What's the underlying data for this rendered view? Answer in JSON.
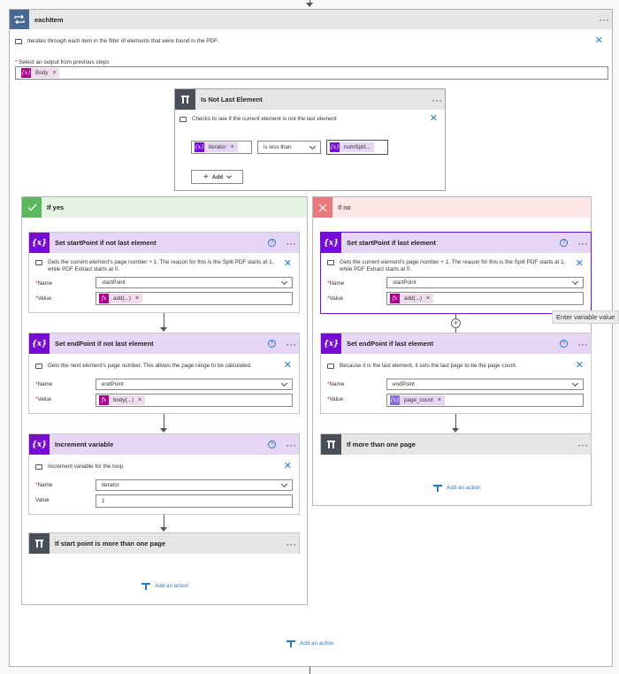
{
  "loop": {
    "title": "eachItem",
    "description": "Iterates through each item in the filter of elements that were found in the PDF.",
    "select_label": "Select an output from previous steps",
    "token": "Body"
  },
  "condition": {
    "title": "Is Not Last Element",
    "description": "Checks to see if the current element is not the last element",
    "left_token": "iterator",
    "operator": "is less than",
    "right_token": "numSplit...",
    "add_label": "Add"
  },
  "if_yes": {
    "label": "If yes",
    "actions": [
      {
        "title": "Set startPoint if not last element",
        "description": "Gets the current element's page number + 1. The reason for this is the Split PDF starts at 1, while PDF Extract starts at 0.",
        "name_label": "Name",
        "name_value": "startPoint",
        "value_label": "Value",
        "value_token": "add(...)"
      },
      {
        "title": "Set endPoint if not last element",
        "description": "Gets the next element's page number. This allows the page range to be calculated.",
        "name_label": "Name",
        "name_value": "endPoint",
        "value_label": "Value",
        "value_token": "body(...)"
      },
      {
        "title": "Increment variable",
        "description": "Increment variable for the loop.",
        "name_label": "Name",
        "name_value": "iterator",
        "value_label": "Value",
        "value_text": "1"
      },
      {
        "title": "If start point is more than one page"
      }
    ],
    "add_action": "Add an action"
  },
  "if_no": {
    "label": "If no",
    "actions": [
      {
        "title": "Set startPoint if last element",
        "description": "Gets the current element's page number + 1. The reason for this is the Split PDF starts at 1, while PDF Extract starts at 0.",
        "name_label": "Name",
        "name_value": "startPoint",
        "value_label": "Value",
        "value_token": "add(...)"
      },
      {
        "title": "Set endPoint if last element",
        "description": "Because it is the last element, it sets the last page to be the page count.",
        "name_label": "Name",
        "name_value": "endPoint",
        "value_label": "Value",
        "value_token": "page_count"
      },
      {
        "title": "If more than one page"
      }
    ],
    "add_action": "Add an action"
  },
  "tooltip": "Enter variable value",
  "footer_add_action": "Add an action",
  "colors": {
    "loop": "#486991",
    "condition": "#484f58",
    "variable": "#770bd6",
    "expression": "#ad008c",
    "yes": "#5cb85c",
    "no": "#e9787d"
  }
}
